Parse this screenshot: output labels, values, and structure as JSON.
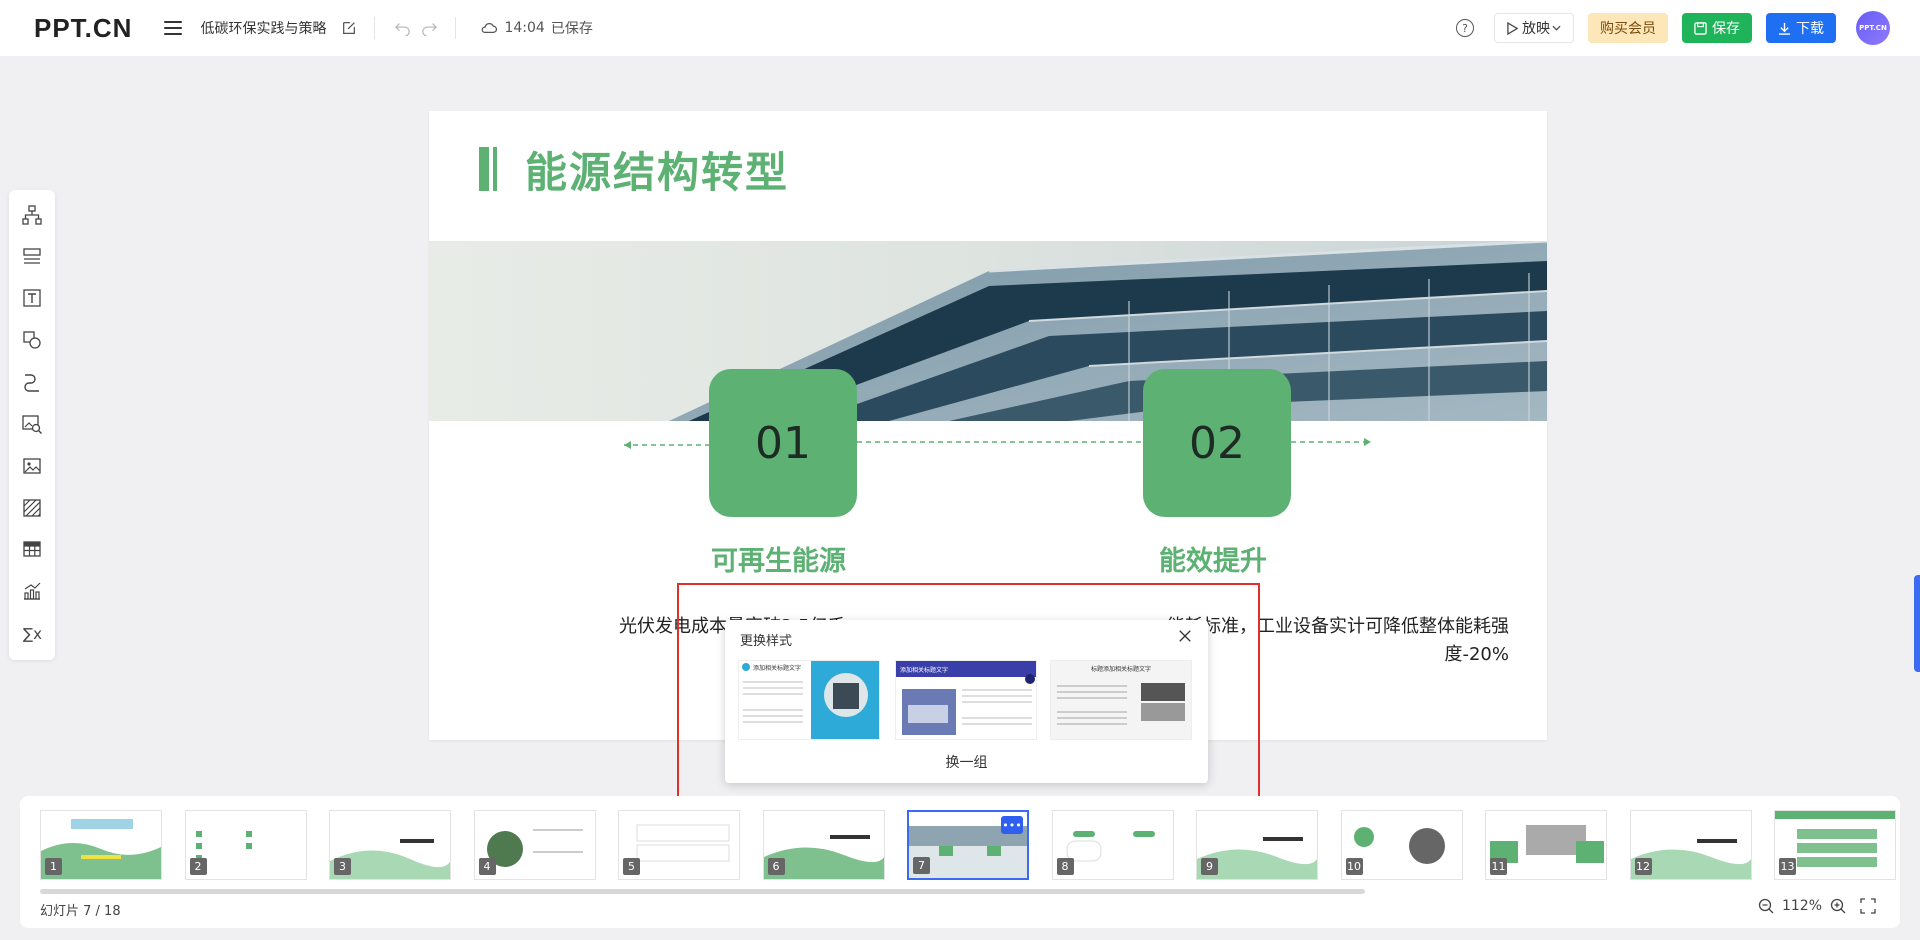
{
  "header": {
    "logo": "PPT.CN",
    "doc_title": "低碳环保实践与策略",
    "save_time": "14:04",
    "save_status": "已保存",
    "play_label": "放映",
    "vip_label": "购买会员",
    "save_label": "保存",
    "download_label": "下载",
    "avatar_text": "PPT.CN"
  },
  "left_tools": [
    "org-chart-icon",
    "layout-icon",
    "text-icon",
    "shape-icon",
    "line-icon",
    "image-search-icon",
    "image-icon",
    "texture-icon",
    "table-icon",
    "chart-icon",
    "formula-icon"
  ],
  "slide": {
    "title": "能源结构转型",
    "items": [
      {
        "num": "01",
        "caption": "可再生能源",
        "text": "光伏发电成本量突破3.5亿千"
      },
      {
        "num": "02",
        "caption": "能效提升",
        "text": "能耗标准，工业设备实计可降低整体能耗强度-20%"
      }
    ],
    "accent": "#5cb173"
  },
  "popup": {
    "title": "更换样式",
    "action": "换一组",
    "options": [
      {
        "heading": "添加相关标题文字"
      },
      {
        "heading": "添加相关标题文字"
      },
      {
        "heading": "标题添加相关标题文字"
      }
    ]
  },
  "thumbnails": [
    {
      "num": "1"
    },
    {
      "num": "2"
    },
    {
      "num": "3"
    },
    {
      "num": "4"
    },
    {
      "num": "5"
    },
    {
      "num": "6"
    },
    {
      "num": "7",
      "active": true
    },
    {
      "num": "8"
    },
    {
      "num": "9"
    },
    {
      "num": "10"
    },
    {
      "num": "11"
    },
    {
      "num": "12"
    },
    {
      "num": "13"
    }
  ],
  "footer": {
    "page_info": "幻灯片 7 / 18",
    "zoom": "112%"
  }
}
